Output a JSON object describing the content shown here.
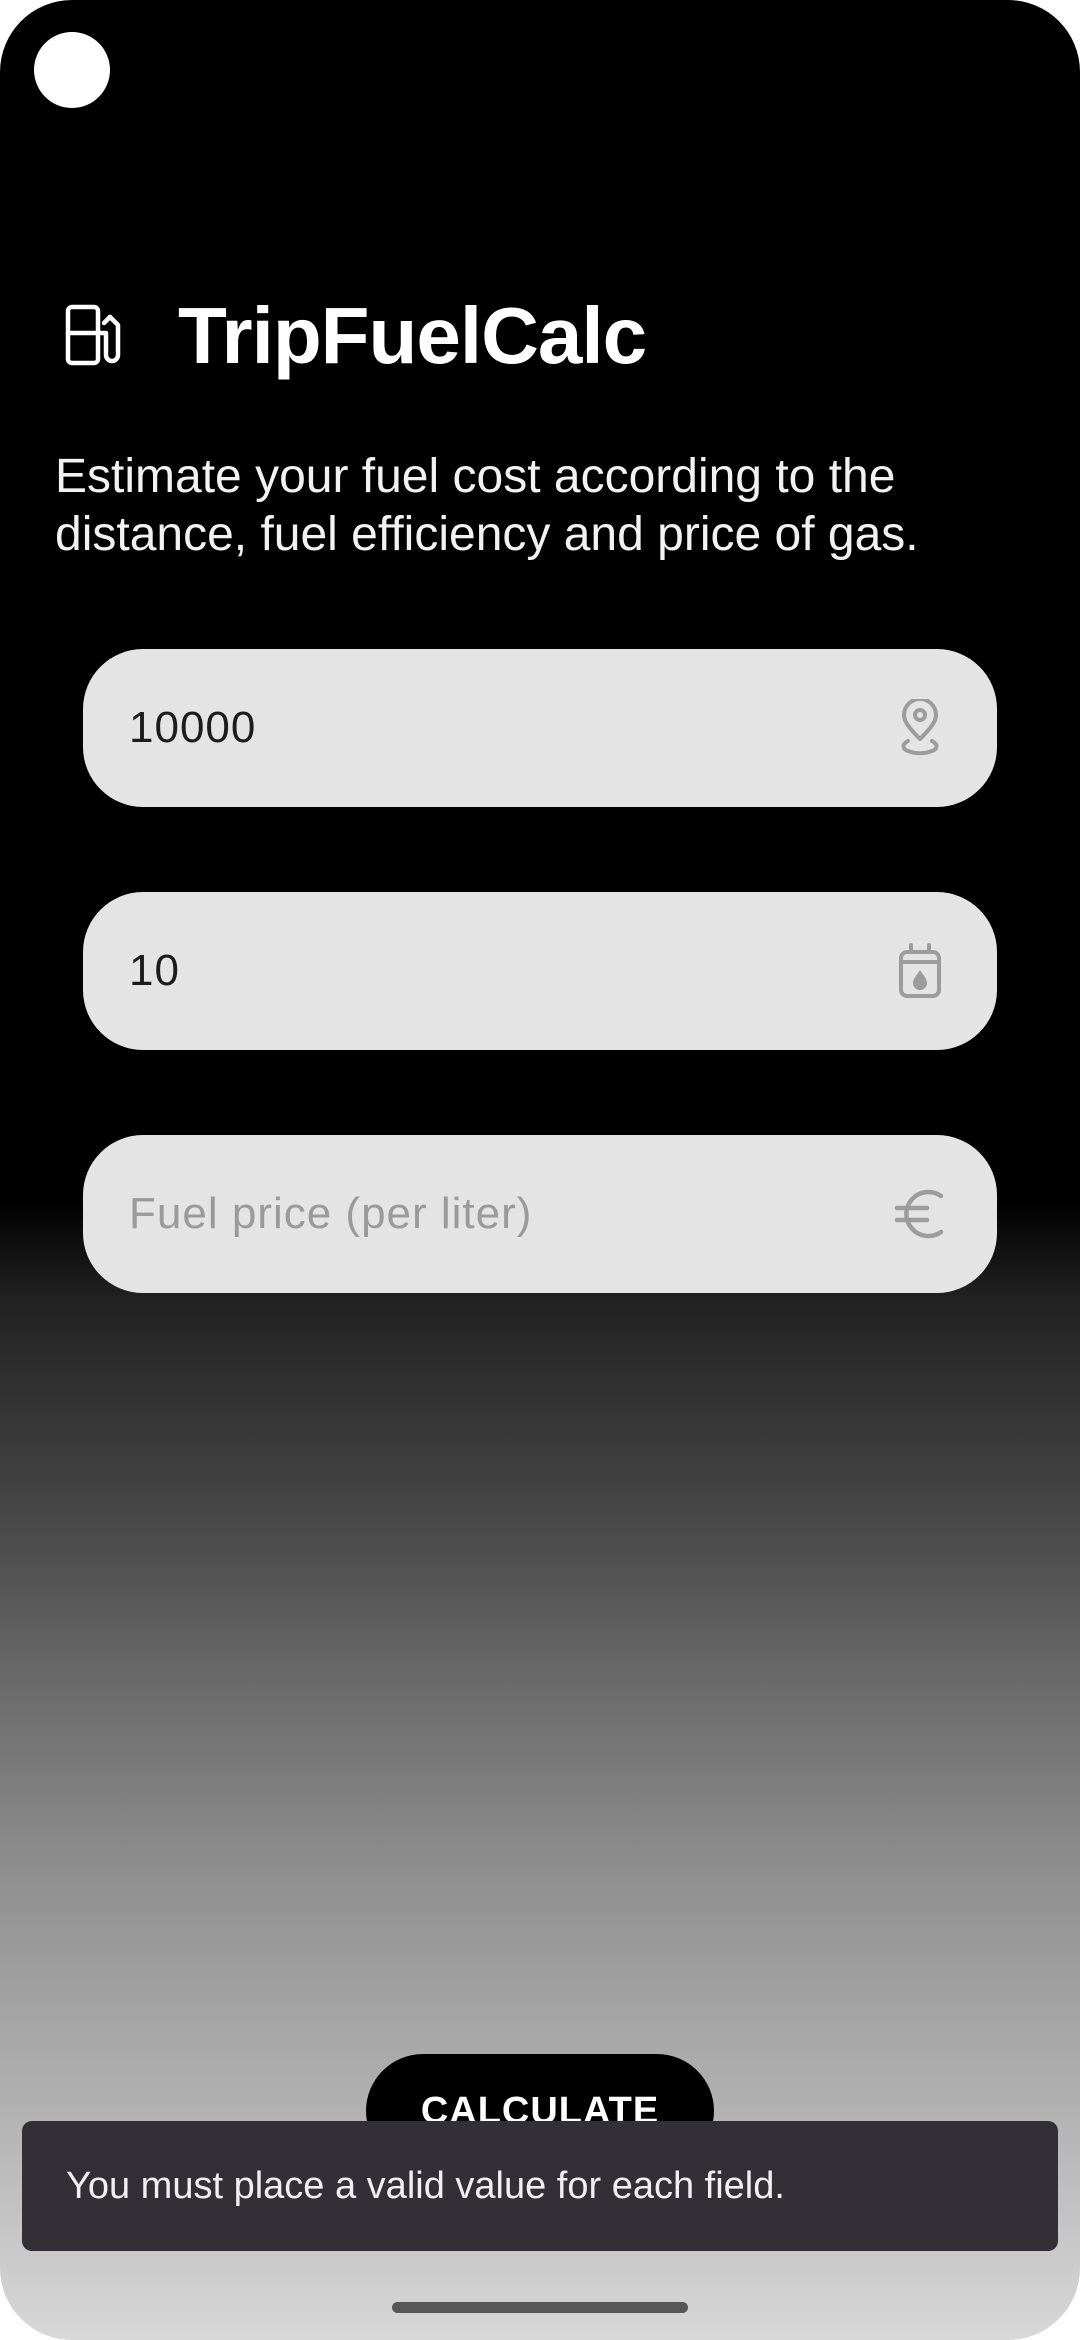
{
  "app": {
    "title": "TripFuelCalc",
    "icon": "fuel-pump-icon",
    "description": "Estimate your fuel cost according to the distance, fuel efficiency and price of gas."
  },
  "fields": [
    {
      "value": "10000",
      "placeholder": "",
      "icon": "location-pin-icon"
    },
    {
      "value": "10",
      "placeholder": "",
      "icon": "fuel-can-icon"
    },
    {
      "value": "",
      "placeholder": "Fuel price (per liter)",
      "icon": "euro-icon"
    }
  ],
  "calculate_label": "CALCULATE",
  "snackbar": {
    "message": "You must place a valid value for each field."
  },
  "colors": {
    "field_bg": "#e4e4e4",
    "icon_gray": "#9c9c9c",
    "snackbar_bg": "#323036",
    "button_bg": "#000000"
  }
}
